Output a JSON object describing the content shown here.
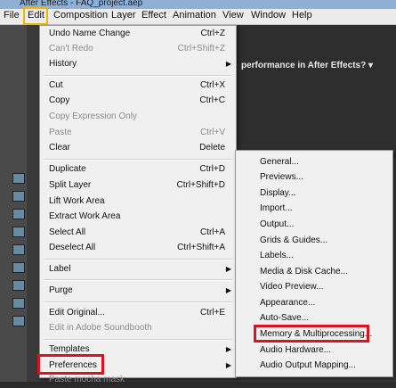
{
  "window": {
    "title_fragment": "After Effects - FAQ_project.aep"
  },
  "menubar": {
    "items": [
      {
        "name": "menu-file",
        "label": "File"
      },
      {
        "name": "menu-edit",
        "label": "Edit"
      },
      {
        "name": "menu-composition",
        "label": "Composition"
      },
      {
        "name": "menu-layer",
        "label": "Layer"
      },
      {
        "name": "menu-effect",
        "label": "Effect"
      },
      {
        "name": "menu-animation",
        "label": "Animation"
      },
      {
        "name": "menu-view",
        "label": "View"
      },
      {
        "name": "menu-window",
        "label": "Window"
      },
      {
        "name": "menu-help",
        "label": "Help"
      }
    ]
  },
  "background": {
    "help_text": "performance in After Effects? ▾"
  },
  "edit_menu": {
    "items": [
      {
        "label": "Undo Name Change",
        "shortcut": "Ctrl+Z",
        "disabled": false
      },
      {
        "label": "Can't Redo",
        "shortcut": "Ctrl+Shift+Z",
        "disabled": true
      },
      {
        "label": "History",
        "submenu": true
      },
      {
        "label": "Cut",
        "shortcut": "Ctrl+X"
      },
      {
        "label": "Copy",
        "shortcut": "Ctrl+C"
      },
      {
        "label": "Copy Expression Only",
        "disabled": true
      },
      {
        "label": "Paste",
        "shortcut": "Ctrl+V",
        "disabled": true
      },
      {
        "label": "Clear",
        "shortcut": "Delete"
      },
      {
        "label": "Duplicate",
        "shortcut": "Ctrl+D"
      },
      {
        "label": "Split Layer",
        "shortcut": "Ctrl+Shift+D"
      },
      {
        "label": "Lift Work Area"
      },
      {
        "label": "Extract Work Area"
      },
      {
        "label": "Select All",
        "shortcut": "Ctrl+A"
      },
      {
        "label": "Deselect All",
        "shortcut": "Ctrl+Shift+A"
      },
      {
        "label": "Label",
        "submenu": true
      },
      {
        "label": "Purge",
        "submenu": true
      },
      {
        "label": "Edit Original...",
        "shortcut": "Ctrl+E"
      },
      {
        "label": "Edit in Adobe Soundbooth",
        "disabled": true
      },
      {
        "label": "Templates",
        "submenu": true
      },
      {
        "label": "Preferences",
        "submenu": true
      },
      {
        "label": "Paste mocha mask",
        "disabled": true
      }
    ]
  },
  "preferences_submenu": {
    "items": [
      {
        "label": "General..."
      },
      {
        "label": "Previews..."
      },
      {
        "label": "Display..."
      },
      {
        "label": "Import..."
      },
      {
        "label": "Output..."
      },
      {
        "label": "Grids & Guides..."
      },
      {
        "label": "Labels..."
      },
      {
        "label": "Media & Disk Cache..."
      },
      {
        "label": "Video Preview..."
      },
      {
        "label": "Appearance..."
      },
      {
        "label": "Auto-Save..."
      },
      {
        "label": "Memory & Multiprocessing..."
      },
      {
        "label": "Audio Hardware..."
      },
      {
        "label": "Audio Output Mapping..."
      }
    ]
  },
  "colors": {
    "menu_bg": "#f0f0f0",
    "annotation_red": "#d8141c",
    "annotation_yellow": "#f0b500"
  }
}
